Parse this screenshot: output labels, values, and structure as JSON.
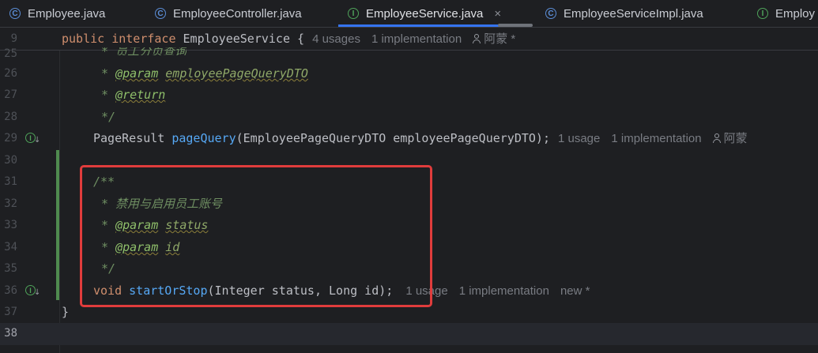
{
  "tabs": [
    {
      "label": "Employee.java",
      "icon": "class-icon",
      "icon_glyph": "C",
      "active": false
    },
    {
      "label": "EmployeeController.java",
      "icon": "class-icon",
      "icon_glyph": "C",
      "active": false
    },
    {
      "label": "EmployeeService.java",
      "icon": "interface-icon",
      "icon_glyph": "I",
      "active": true,
      "close": "×"
    },
    {
      "label": "EmployeeServiceImpl.java",
      "icon": "class-icon",
      "icon_glyph": "C",
      "active": false
    },
    {
      "label": "Employ",
      "icon": "interface-icon",
      "icon_glyph": "I",
      "active": false
    }
  ],
  "sticky_line": {
    "number": "9",
    "kw1": "public",
    "kw2": "interface",
    "name": "EmployeeService {",
    "hint_usages": "4 usages",
    "hint_impl": "1 implementation",
    "hint_author": "阿蒙 *"
  },
  "lines": [
    {
      "n": "25",
      "text": "* 员工分页查询"
    },
    {
      "n": "26",
      "star": "* ",
      "tag": "@param",
      "param": "employeePageQueryDTO"
    },
    {
      "n": "27",
      "star": "* ",
      "tag": "@return"
    },
    {
      "n": "28",
      "text": "*/"
    },
    {
      "n": "29",
      "type": "PageResult ",
      "method": "pageQuery",
      "args": "(EmployeePageQueryDTO employeePageQueryDTO);",
      "hint_usages": "1 usage",
      "hint_impl": "1 implementation",
      "hint_author": "阿蒙"
    },
    {
      "n": "30"
    },
    {
      "n": "31",
      "text": "/**"
    },
    {
      "n": "32",
      "text": "* 禁用与启用员工账号"
    },
    {
      "n": "33",
      "star": "* ",
      "tag": "@param",
      "param": "status"
    },
    {
      "n": "34",
      "star": "* ",
      "tag": "@param",
      "param": "id"
    },
    {
      "n": "35",
      "text": "*/"
    },
    {
      "n": "36",
      "kw": "void ",
      "method": "startOrStop",
      "args": "(Integer status, Long id);",
      "hint_usages": "1 usage",
      "hint_impl": "1 implementation",
      "hint_new": "new *"
    },
    {
      "n": "37",
      "text": "}"
    },
    {
      "n": "38"
    }
  ],
  "gutter_icon_glyph": "I",
  "gutter_arrow": "↓",
  "colors": {
    "highlight_box": "#e03c3c",
    "vcs_added": "#4f8a4f",
    "accent": "#3574f0"
  }
}
